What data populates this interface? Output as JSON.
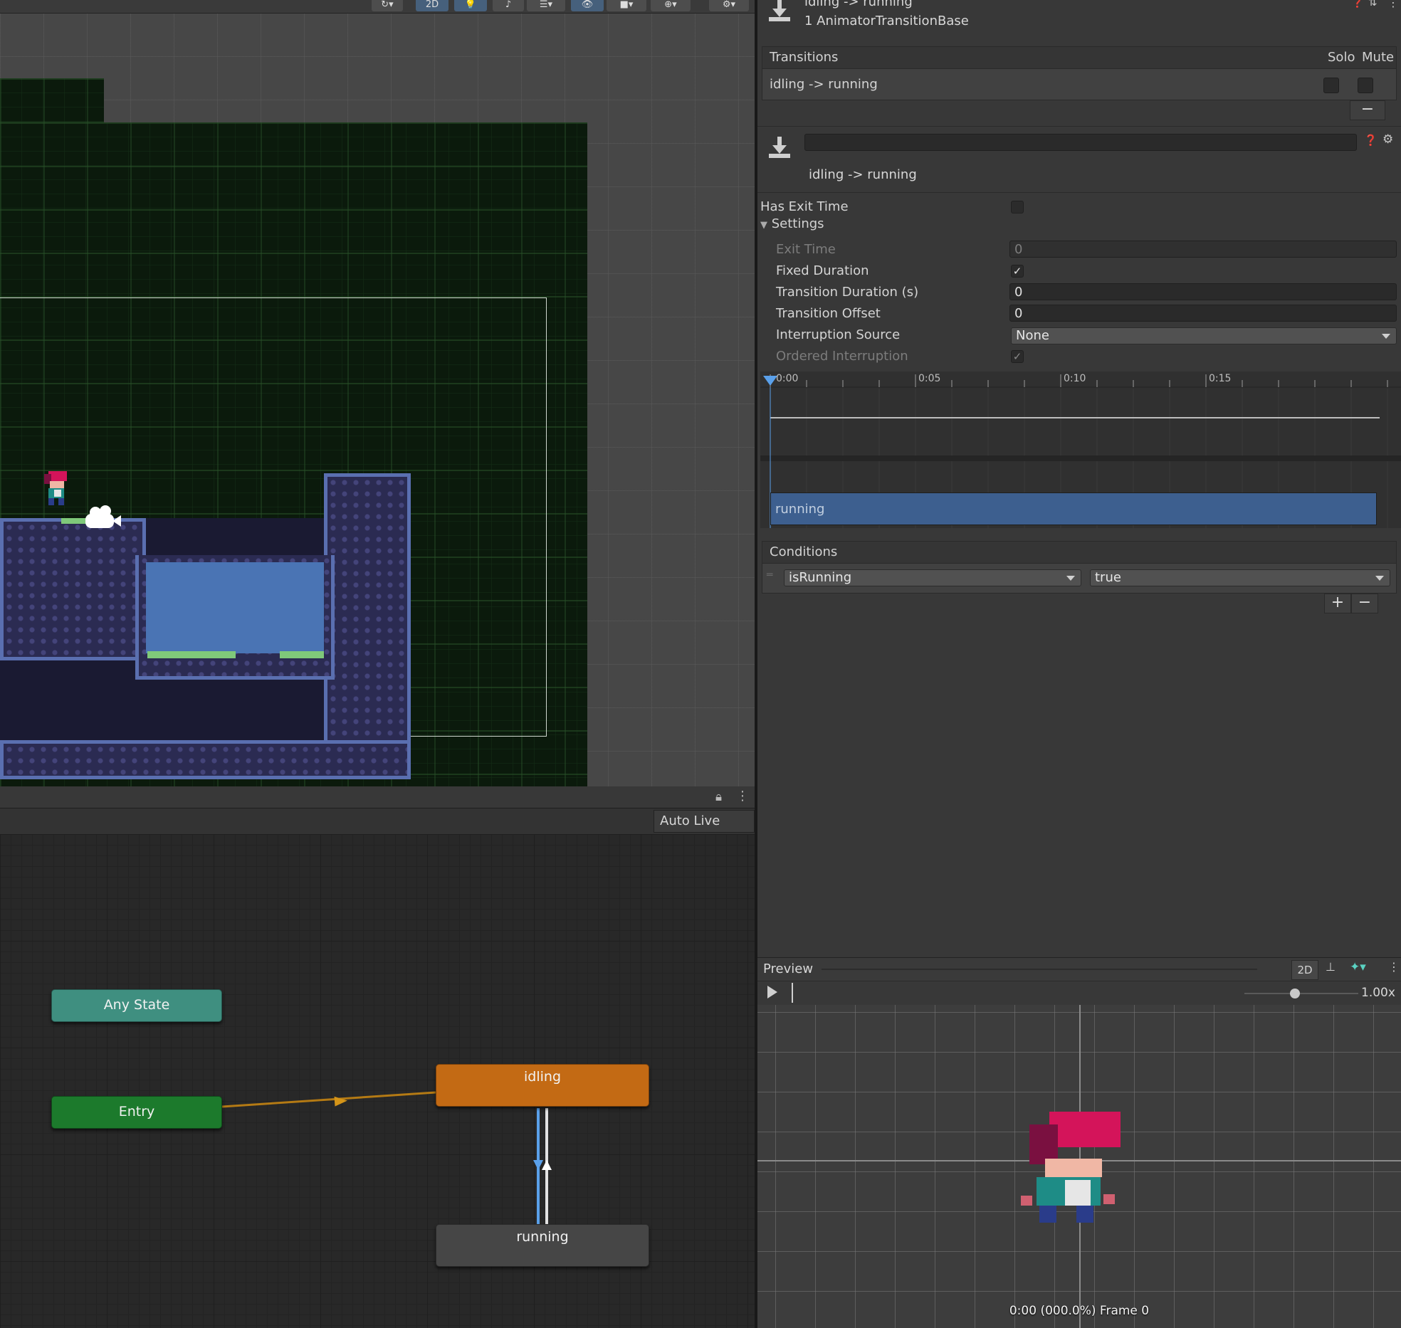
{
  "scene": {
    "toolbar": {
      "mode_2d": "2D"
    }
  },
  "animator": {
    "auto_live_link": "Auto Live Link",
    "nodes": {
      "any_state": "Any State",
      "entry": "Entry",
      "idling": "idling",
      "running": "running"
    }
  },
  "inspector": {
    "header_title": "idling -> running",
    "header_subtitle": "1 AnimatorTransitionBase",
    "transitions": {
      "title": "Transitions",
      "solo": "Solo",
      "mute": "Mute",
      "items": [
        {
          "label": "idling -> running",
          "solo": false,
          "mute": false
        }
      ],
      "remove_label": "−"
    },
    "transition_name": "idling -> running",
    "has_exit_time": {
      "label": "Has Exit Time",
      "checked": false
    },
    "settings": {
      "label": "Settings",
      "exit_time": {
        "label": "Exit Time",
        "value": "0"
      },
      "fixed_duration": {
        "label": "Fixed Duration",
        "checked": true
      },
      "transition_duration": {
        "label": "Transition Duration (s)",
        "value": "0"
      },
      "transition_offset": {
        "label": "Transition Offset",
        "value": "0"
      },
      "interruption_source": {
        "label": "Interruption Source",
        "value": "None"
      },
      "ordered_interruption": {
        "label": "Ordered Interruption",
        "checked": true
      }
    },
    "timeline": {
      "ticks": [
        "0:00",
        "0:05",
        "0:10",
        "0:15"
      ],
      "clip": "running"
    },
    "conditions": {
      "title": "Conditions",
      "items": [
        {
          "parameter": "isRunning",
          "value": "true"
        }
      ],
      "add_label": "+",
      "remove_label": "−"
    }
  },
  "preview": {
    "title": "Preview",
    "mode_2d": "2D",
    "speed": "1.00x",
    "status": "0:00 (000.0%) Frame 0"
  },
  "colors": {
    "any_state": "#3f8f80",
    "entry": "#1c7a2c",
    "idling": "#c36a14",
    "running": "#464646",
    "clip_bar": "#3d5f8f",
    "selection": "#46607c"
  }
}
